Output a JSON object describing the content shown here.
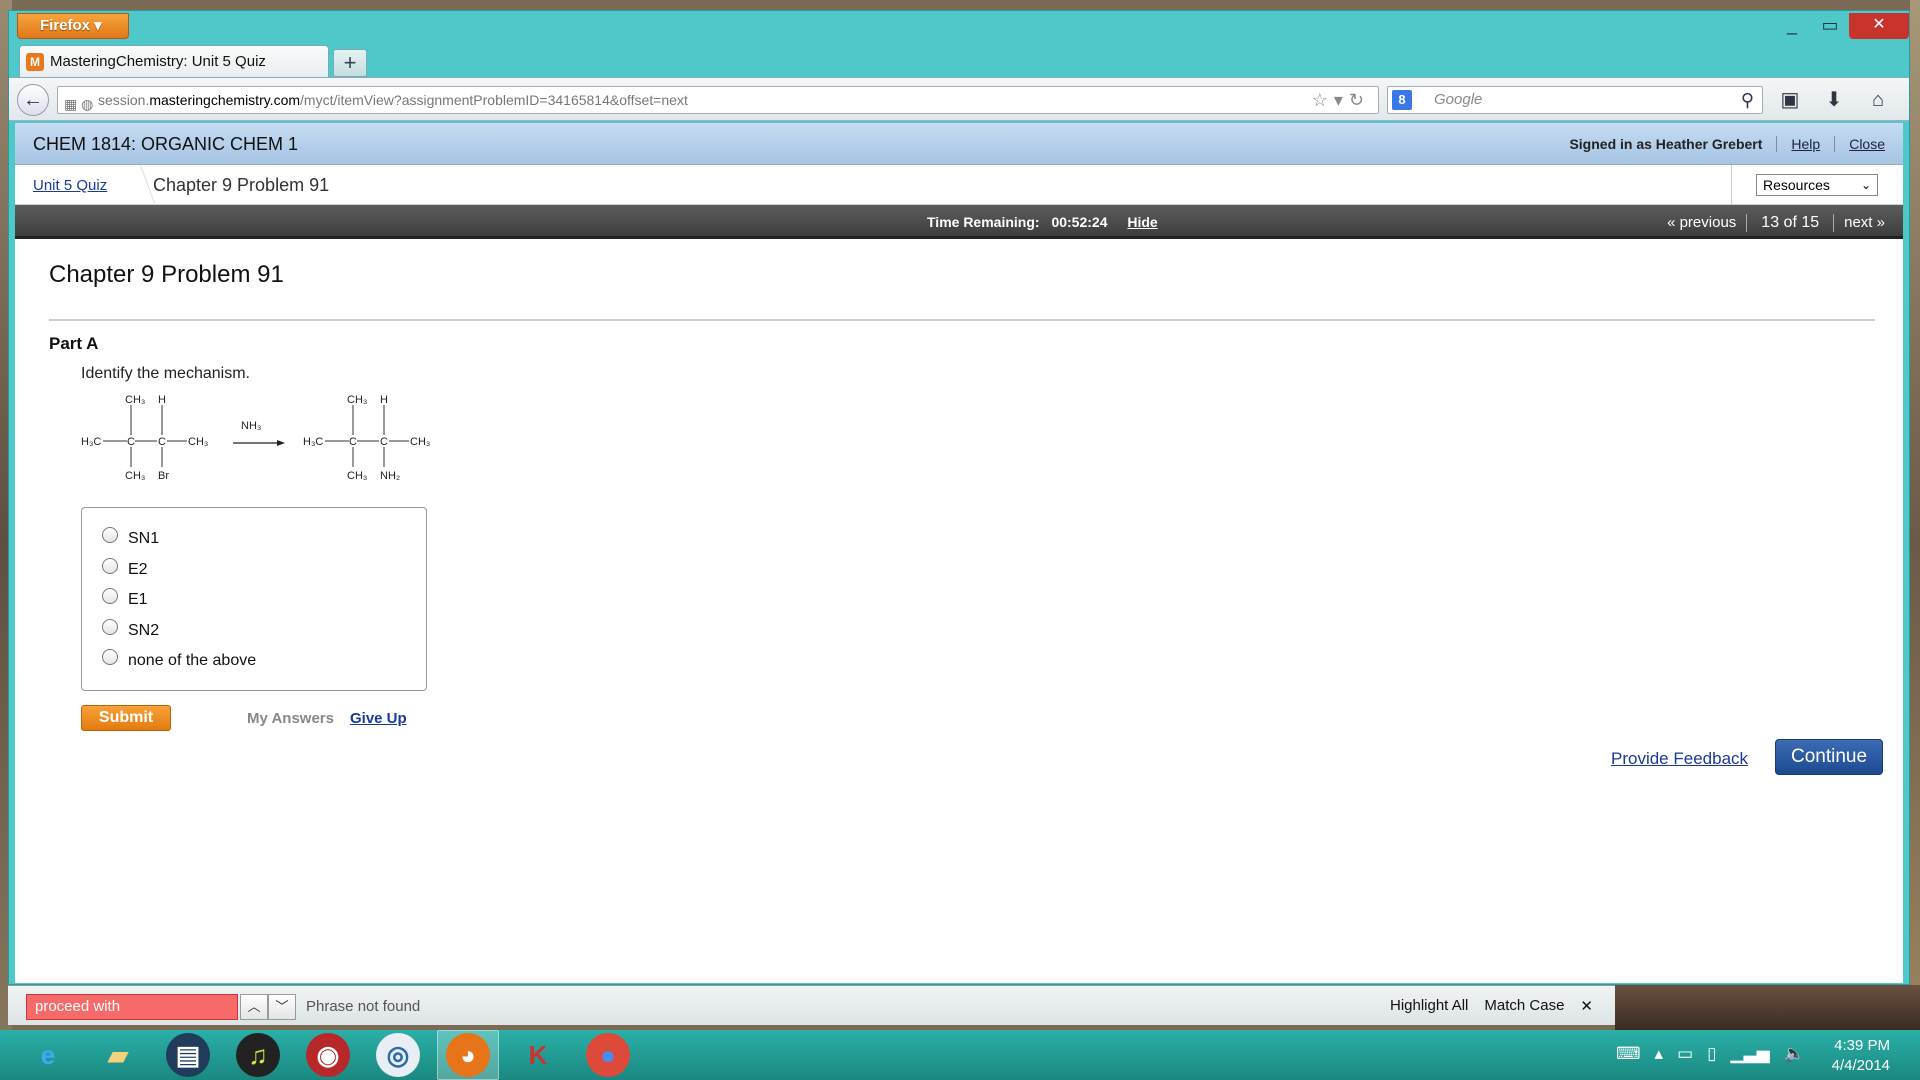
{
  "browser": {
    "app_button": "Firefox",
    "tab_title": "MasteringChemistry: Unit 5 Quiz",
    "new_tab": "+",
    "url_prefix": "session.",
    "url_host": "masteringchemistry.com",
    "url_path": "/myct/itemView?assignmentProblemID=34165814&offset=next",
    "search_placeholder": "Google",
    "window_close": "✕"
  },
  "course": {
    "title": "CHEM 1814: ORGANIC CHEM 1",
    "signed_in": "Signed in as Heather Grebert",
    "help": "Help",
    "close": "Close"
  },
  "breadcrumb": {
    "parent": "Unit 5 Quiz",
    "current": "Chapter 9 Problem 91",
    "resources": "Resources"
  },
  "timer": {
    "label": "Time Remaining:",
    "value": "00:52:24",
    "hide": "Hide"
  },
  "pager": {
    "previous": "« previous",
    "position": "13 of 15",
    "next": "next »"
  },
  "problem": {
    "title": "Chapter 9 Problem 91",
    "part": "Part A",
    "question": "Identify the mechanism.",
    "reagent": "NH₃",
    "choices": [
      "SN1",
      "E2",
      "E1",
      "SN2",
      "none of the above"
    ]
  },
  "actions": {
    "submit": "Submit",
    "my_answers": "My Answers",
    "give_up": "Give Up",
    "feedback": "Provide Feedback",
    "continue": "Continue"
  },
  "findbar": {
    "query": "proceed with",
    "status": "Phrase not found",
    "highlight_all": "Highlight All",
    "match_case": "Match Case",
    "close": "✕"
  },
  "taskbar": {
    "time": "4:39 PM",
    "date": "4/4/2014"
  },
  "colors": {
    "window_frame": "#4ec8c8",
    "submit": "#e27b10",
    "continue": "#1e4a92",
    "find_not_found": "#f66a6a",
    "taskbar": "#1a8880"
  }
}
